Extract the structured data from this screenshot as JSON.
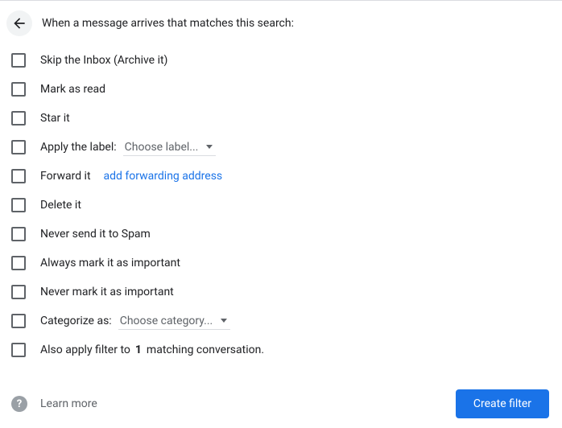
{
  "header": {
    "title": "When a message arrives that matches this search:"
  },
  "options": {
    "skip_inbox": "Skip the Inbox (Archive it)",
    "mark_read": "Mark as read",
    "star_it": "Star it",
    "apply_label_prefix": "Apply the label:",
    "apply_label_dropdown": "Choose label...",
    "forward_it": "Forward it",
    "forward_link": "add forwarding address",
    "delete_it": "Delete it",
    "never_spam": "Never send it to Spam",
    "always_important": "Always mark it as important",
    "never_important": "Never mark it as important",
    "categorize_prefix": "Categorize as:",
    "categorize_dropdown": "Choose category...",
    "also_apply_prefix": "Also apply filter to",
    "also_apply_count": "1",
    "also_apply_suffix": "matching conversation."
  },
  "footer": {
    "help_glyph": "?",
    "learn_more": "Learn more",
    "create_button": "Create filter"
  }
}
